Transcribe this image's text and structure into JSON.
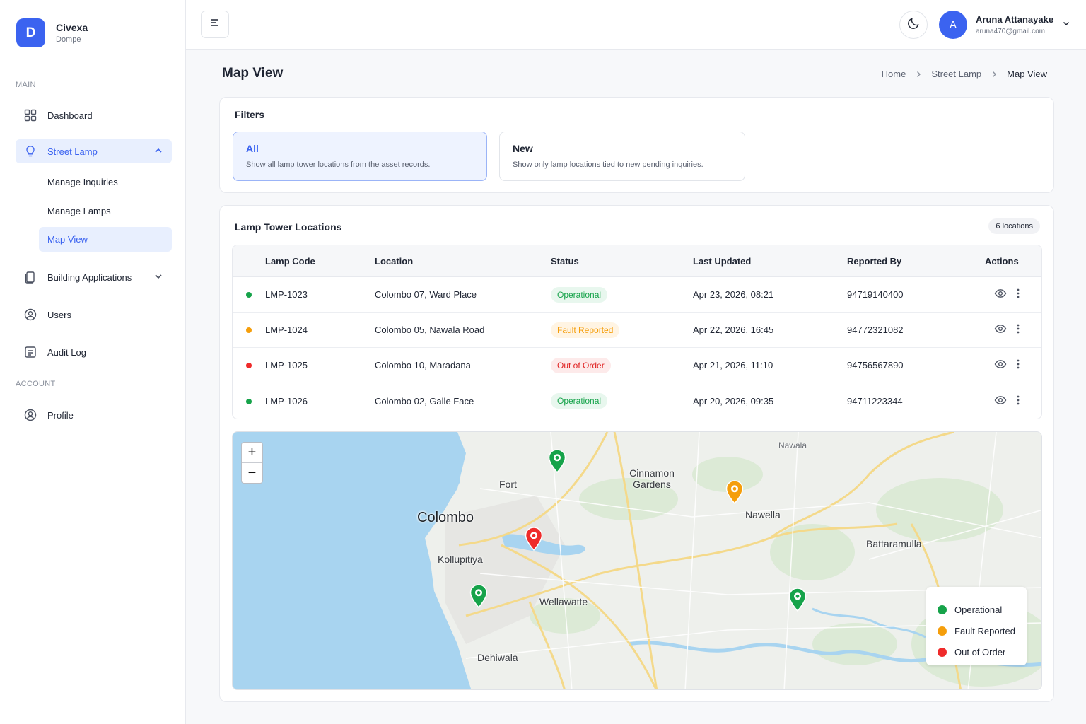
{
  "brand": {
    "logo_letter": "D",
    "name": "Civexa",
    "sub": "Dompe"
  },
  "sidebar": {
    "main_label": "MAIN",
    "account_label": "ACCOUNT",
    "dashboard": "Dashboard",
    "street_lamp": "Street Lamp",
    "sub_items": [
      "Manage Inquiries",
      "Manage Lamps",
      "Map View"
    ],
    "building_applications": "Building Applications",
    "users": "Users",
    "audit_log": "Audit Log",
    "profile": "Profile"
  },
  "topbar": {
    "user_initial": "A",
    "user_name": "Aruna Attanayake",
    "user_email": "aruna470@gmail.com"
  },
  "page": {
    "title": "Map View",
    "breadcrumb": [
      "Home",
      "Street Lamp",
      "Map View"
    ]
  },
  "filters": {
    "title": "Filters",
    "options": [
      {
        "title": "All",
        "desc": "Show all lamp tower locations from the asset records."
      },
      {
        "title": "New",
        "desc": "Show only lamp locations tied to new pending inquiries."
      }
    ]
  },
  "locations": {
    "title": "Lamp Tower Locations",
    "count_label": "6 locations",
    "columns": [
      "Lamp Code",
      "Location",
      "Status",
      "Last Updated",
      "Reported By",
      "Actions"
    ],
    "rows": [
      {
        "code": "LMP-1023",
        "location": "Colombo 07, Ward Place",
        "status": "Operational",
        "updated": "Apr 23, 2026, 08:21",
        "reported_by": "94719140400"
      },
      {
        "code": "LMP-1024",
        "location": "Colombo 05, Nawala Road",
        "status": "Fault Reported",
        "updated": "Apr 22, 2026, 16:45",
        "reported_by": "94772321082"
      },
      {
        "code": "LMP-1025",
        "location": "Colombo 10, Maradana",
        "status": "Out of Order",
        "updated": "Apr 21, 2026, 11:10",
        "reported_by": "94756567890"
      },
      {
        "code": "LMP-1026",
        "location": "Colombo 02, Galle Face",
        "status": "Operational",
        "updated": "Apr 20, 2026, 09:35",
        "reported_by": "94711223344"
      }
    ]
  },
  "status_colors": {
    "Operational": {
      "dot": "#16a34a",
      "text": "#16a34a",
      "bg": "#e8f7ee"
    },
    "Fault Reported": {
      "dot": "#f59e0b",
      "text": "#f59e0b",
      "bg": "#fff4e3"
    },
    "Out of Order": {
      "dot": "#ef2b2b",
      "text": "#e02424",
      "bg": "#fdeaea"
    }
  },
  "map": {
    "zoom_in": "+",
    "zoom_out": "−",
    "places": [
      "Colombo",
      "Fort",
      "Cinnamon Gardens",
      "Nawella",
      "Battaramulla",
      "Kollupitiya",
      "Wellawatte",
      "Dehiwala",
      "Nawala"
    ],
    "pins": [
      "Operational",
      "Fault Reported",
      "Out of Order",
      "Operational",
      "Operational"
    ],
    "legend": [
      "Operational",
      "Fault Reported",
      "Out of Order"
    ]
  },
  "accent_color": "#3b63f0"
}
